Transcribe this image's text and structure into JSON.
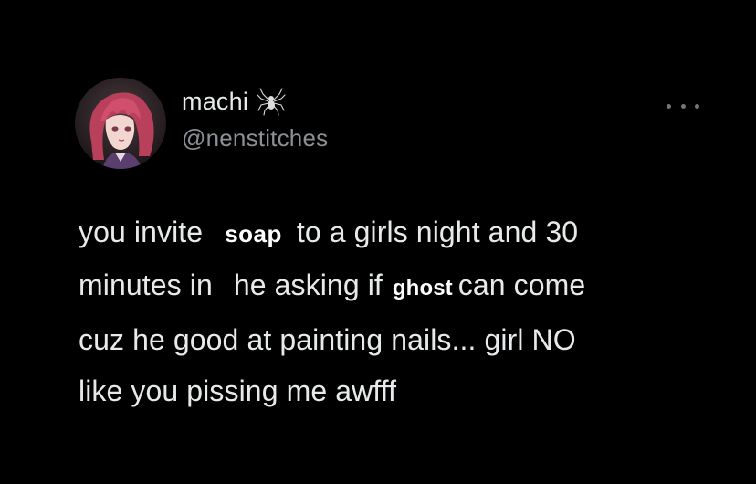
{
  "author": {
    "display_name": "machi",
    "handle": "@nenstitches",
    "badge_icon": "spider-icon",
    "avatar": "anime-character-avatar"
  },
  "menu": {
    "icon": "more-options-icon"
  },
  "tweet": {
    "line1_before": "you invite",
    "sticker1": "soap",
    "line1_after": "to a girls night and 30",
    "line2_before": "minutes in",
    "line2_middle": "he asking if",
    "sticker2": "ghost",
    "line2_after": "can come",
    "line3": "cuz he good at painting nails... girl NO",
    "line4": "like you pissing me awfff"
  },
  "colors": {
    "background": "#000000",
    "text_primary": "#e7e9ea",
    "text_secondary": "#8b9095"
  }
}
